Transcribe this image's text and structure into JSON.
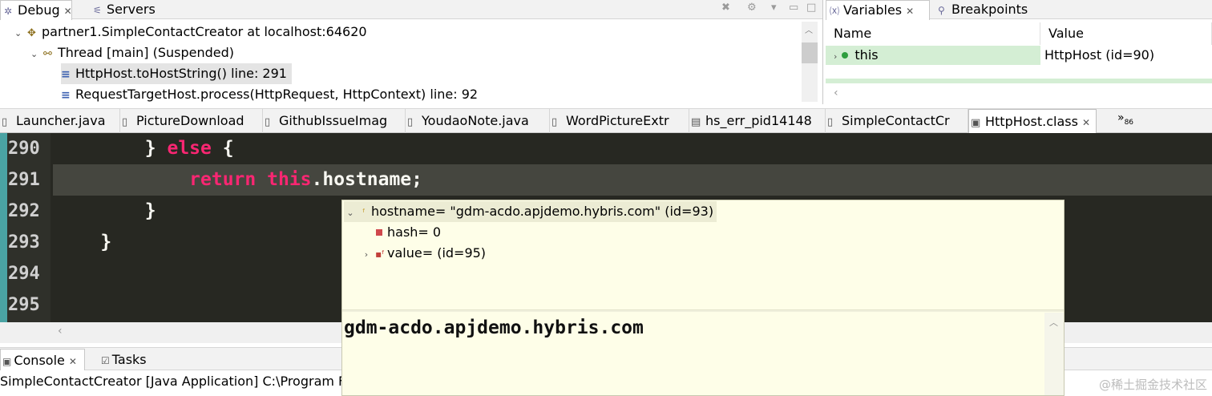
{
  "debug": {
    "tabs": [
      {
        "label": "Debug",
        "icon": "bug-icon",
        "active": true
      },
      {
        "label": "Servers",
        "icon": "server-icon",
        "active": false
      }
    ],
    "close_glyph": "✕",
    "tree": [
      {
        "label": "partner1.SimpleContactCreator at localhost:64620",
        "level": 0,
        "twisty": "expanded",
        "icon": "java-launch-icon"
      },
      {
        "label": "Thread [main] (Suspended)",
        "level": 1,
        "twisty": "expanded",
        "icon": "thread-suspended-icon"
      },
      {
        "label": "HttpHost.toHostString() line: 291",
        "level": 2,
        "twisty": "none",
        "icon": "stack-frame-icon",
        "selected": true
      },
      {
        "label": "RequestTargetHost.process(HttpRequest, HttpContext) line: 92",
        "level": 2,
        "twisty": "none",
        "icon": "stack-frame-icon"
      }
    ]
  },
  "variables": {
    "tabs": [
      {
        "label": "Variables",
        "icon": "variables-icon",
        "active": true
      },
      {
        "label": "Breakpoints",
        "icon": "breakpoints-icon",
        "active": false
      }
    ],
    "columns": [
      "Name",
      "Value"
    ],
    "rows": [
      {
        "name": "this",
        "value": "HttpHost  (id=90)"
      }
    ]
  },
  "editor_tabs": [
    {
      "label": "Launcher.java",
      "icon": "java-file-icon"
    },
    {
      "label": "PictureDownload",
      "icon": "java-file-icon"
    },
    {
      "label": "GithubIssueImag",
      "icon": "java-file-icon"
    },
    {
      "label": "YoudaoNote.java",
      "icon": "java-file-icon"
    },
    {
      "label": "WordPictureExtr",
      "icon": "java-file-icon"
    },
    {
      "label": "hs_err_pid14148",
      "icon": "text-file-icon"
    },
    {
      "label": "SimpleContactCr",
      "icon": "java-file-icon"
    },
    {
      "label": "HttpHost.class",
      "icon": "class-file-icon",
      "active": true
    }
  ],
  "editor_overflow": {
    "glyph": "»",
    "count": "86"
  },
  "code": {
    "lines": [
      {
        "number": "290",
        "tokens": [
          {
            "t": "        } ",
            "k": "plain"
          },
          {
            "t": "else",
            "k": "kw"
          },
          {
            "t": " {",
            "k": "plain"
          }
        ]
      },
      {
        "number": "291",
        "tokens": [
          {
            "t": "            ",
            "k": "plain"
          },
          {
            "t": "return",
            "k": "kw"
          },
          {
            "t": " ",
            "k": "plain"
          },
          {
            "t": "this",
            "k": "kw"
          },
          {
            "t": ".hostname;",
            "k": "plain"
          }
        ],
        "current": true
      },
      {
        "number": "292",
        "tokens": [
          {
            "t": "        }",
            "k": "plain"
          }
        ]
      },
      {
        "number": "293",
        "tokens": [
          {
            "t": "    }",
            "k": "plain"
          }
        ]
      },
      {
        "number": "294",
        "tokens": []
      },
      {
        "number": "295",
        "tokens": []
      }
    ]
  },
  "hover": {
    "root": {
      "label": "hostname= \"gdm-acdo.apjdemo.hybris.com\" (id=93)",
      "icon": "final-field-icon"
    },
    "children": [
      {
        "label": "hash= 0",
        "icon": "private-field-icon"
      },
      {
        "label": "value= (id=95)",
        "icon": "private-final-field-icon",
        "expandable": true
      }
    ],
    "detail": "gdm-acdo.apjdemo.hybris.com"
  },
  "console": {
    "tabs": [
      {
        "label": "Console",
        "icon": "console-icon",
        "active": true
      },
      {
        "label": "Tasks",
        "icon": "tasks-icon",
        "active": false
      }
    ],
    "text": "SimpleContactCreator [Java Application] C:\\Program File"
  },
  "watermark": "@稀土掘金技术社区",
  "colors": {
    "editor_bg": "#272822",
    "keyword": "#f92672",
    "current_line": "#45463f",
    "hover_bg": "#fefee8",
    "variable_highlight": "#d4eed4"
  }
}
